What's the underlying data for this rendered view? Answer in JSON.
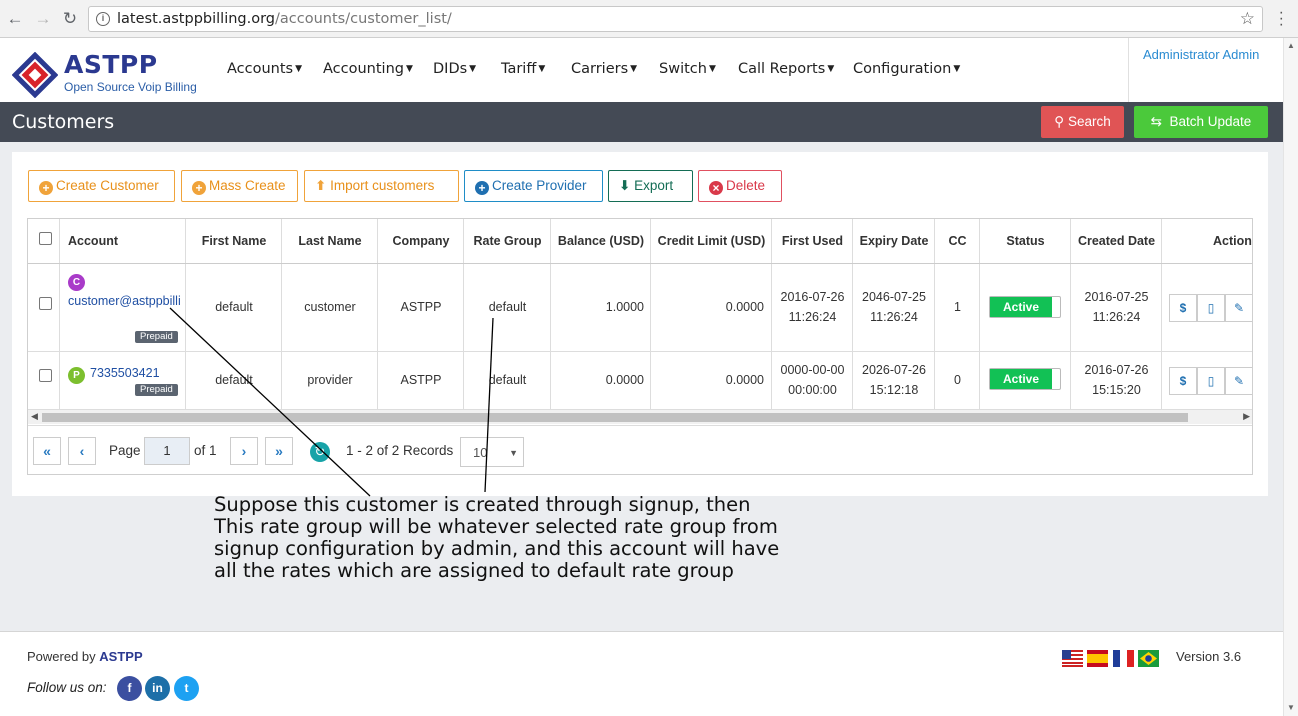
{
  "browser": {
    "url_host": "latest.astppbilling.org",
    "url_path": "/accounts/customer_list/"
  },
  "brand": {
    "name": "ASTPP",
    "tagline": "Open Source Voip Billing"
  },
  "menu": [
    "Accounts",
    "Accounting",
    "DIDs",
    "Tariff",
    "Carriers",
    "Switch",
    "Call Reports",
    "Configuration"
  ],
  "user": "Administrator Admin",
  "page": {
    "title": "Customers",
    "search_label": "Search",
    "batch_update_label": "Batch Update"
  },
  "actions": {
    "create_customer": "Create Customer",
    "mass_create": "Mass Create",
    "import_customers": "Import customers",
    "create_provider": "Create Provider",
    "export": "Export",
    "delete": "Delete"
  },
  "table": {
    "columns": [
      "Account",
      "First Name",
      "Last Name",
      "Company",
      "Rate Group",
      "Balance (USD)",
      "Credit Limit (USD)",
      "First Used",
      "Expiry Date",
      "CC",
      "Status",
      "Created Date",
      "Action"
    ],
    "rows": [
      {
        "badge": "C",
        "account": "customer@astppbilli",
        "type": "Prepaid",
        "first_name": "default",
        "last_name": "customer",
        "company": "ASTPP",
        "rate_group": "default",
        "balance": "1.0000",
        "credit_limit": "0.0000",
        "first_used_date": "2016-07-26",
        "first_used_time": "11:26:24",
        "expiry_date": "2046-07-25",
        "expiry_time": "11:26:24",
        "cc": "1",
        "status": "Active",
        "created_date": "2016-07-25",
        "created_time": "11:26:24"
      },
      {
        "badge": "P",
        "account": "7335503421",
        "type": "Prepaid",
        "first_name": "default",
        "last_name": "provider",
        "company": "ASTPP",
        "rate_group": "default",
        "balance": "0.0000",
        "credit_limit": "0.0000",
        "first_used_date": "0000-00-00",
        "first_used_time": "00:00:00",
        "expiry_date": "2026-07-26",
        "expiry_time": "15:12:18",
        "cc": "0",
        "status": "Active",
        "created_date": "2016-07-26",
        "created_time": "15:15:20"
      }
    ]
  },
  "pager": {
    "page_label": "Page",
    "page": "1",
    "of_label": "of 1",
    "records": "1 - 2 of 2 Records",
    "per_page": "10"
  },
  "annotation": [
    "Suppose this customer is created through signup, then",
    "This rate group will be whatever selected rate group from",
    "signup configuration by admin, and this account will have",
    "all the rates which are assigned to default rate group"
  ],
  "footer": {
    "powered_label": "Powered by",
    "powered_brand": "ASTPP",
    "follow": "Follow us on:",
    "version": "Version 3.6"
  },
  "colors": {
    "navy": "#2b3990",
    "titlebar": "#444a55",
    "search": "#e05455",
    "batch": "#4bc93b",
    "active": "#12c155"
  }
}
